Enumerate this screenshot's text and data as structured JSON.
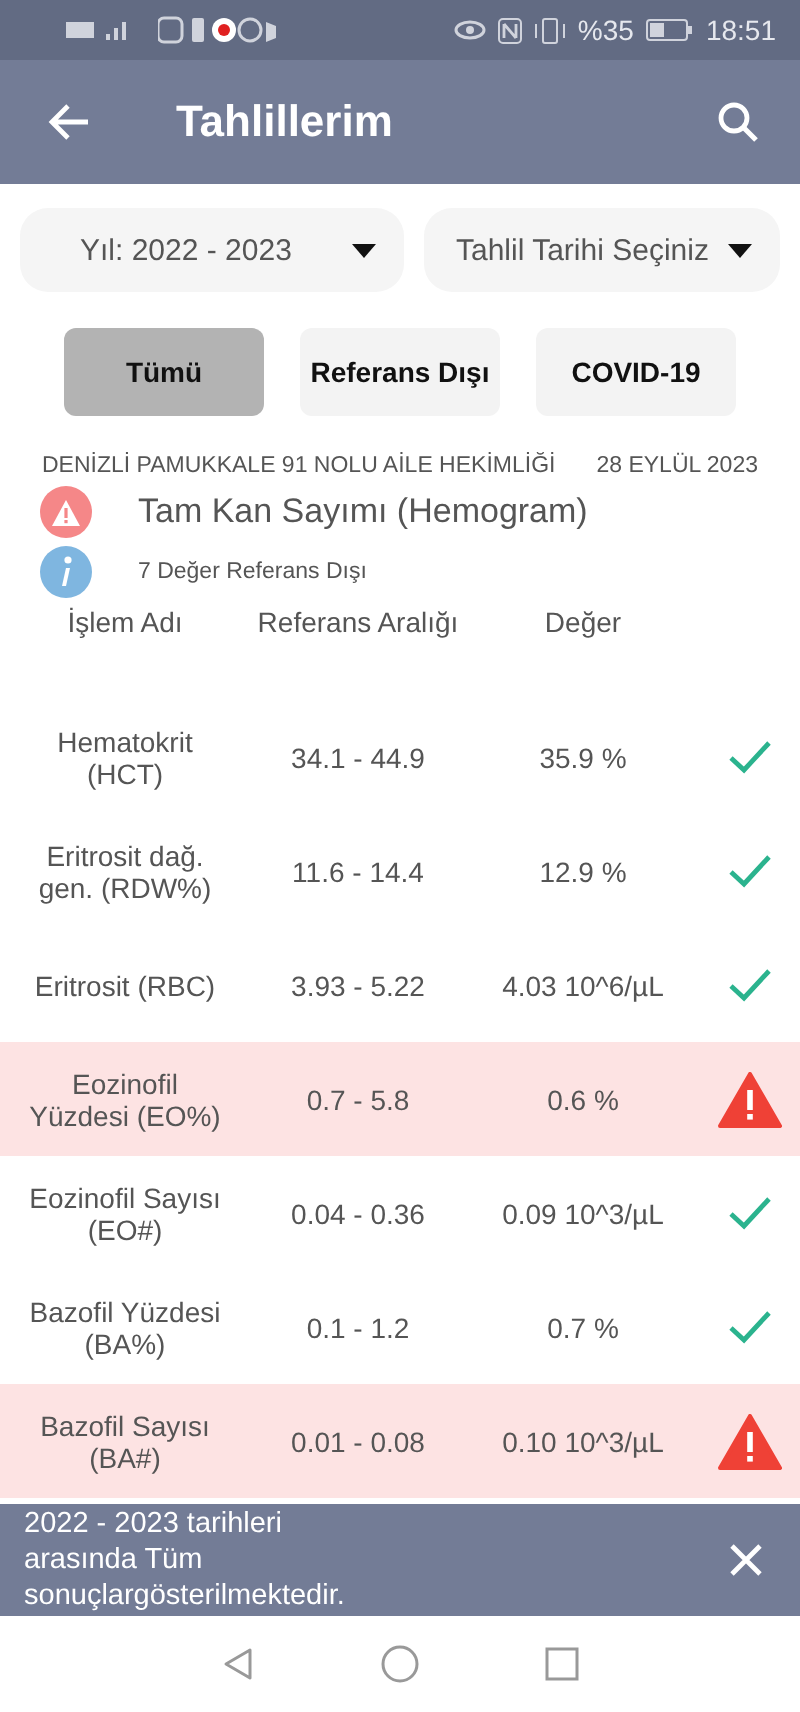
{
  "status_bar": {
    "battery": "%35",
    "time": "18:51"
  },
  "app_bar": {
    "title": "Tahlillerim"
  },
  "filters": {
    "year": "Yıl: 2022 - 2023",
    "date": {
      "placeholder": "Tahlil Tarihi Seçiniz"
    }
  },
  "tabs": [
    {
      "label": "Tümü",
      "selected": true
    },
    {
      "label": "Referans Dışı",
      "selected": false
    },
    {
      "label": "COVID-19",
      "selected": false
    }
  ],
  "report": {
    "institution": "DENİZLİ PAMUKKALE 91 NOLU AİLE HEKİMLİĞİ",
    "date": "28 EYLÜL 2023",
    "title": "Tam Kan Sayımı (Hemogram)",
    "summary": "7 Değer Referans Dışı"
  },
  "table": {
    "columns": [
      "İşlem Adı",
      "Referans Aralığı",
      "Değer"
    ],
    "rows": [
      {
        "name": "Hematokrit (HCT)",
        "range": "34.1 - 44.9",
        "value": "35.9 %",
        "out_of_range": false
      },
      {
        "name": "Eritrosit dağ. gen. (RDW%)",
        "range": "11.6 - 14.4",
        "value": "12.9 %",
        "out_of_range": false
      },
      {
        "name": "Eritrosit (RBC)",
        "range": "3.93 - 5.22",
        "value": "4.03 10^6/µL",
        "out_of_range": false
      },
      {
        "name": "Eozinofil Yüzdesi (EO%)",
        "range": "0.7 - 5.8",
        "value": "0.6 %",
        "out_of_range": true
      },
      {
        "name": "Eozinofil Sayısı (EO#)",
        "range": "0.04 - 0.36",
        "value": "0.09 10^3/µL",
        "out_of_range": false
      },
      {
        "name": "Bazofil Yüzdesi (BA%)",
        "range": "0.1 - 1.2",
        "value": "0.7 %",
        "out_of_range": false
      },
      {
        "name": "Bazofil Sayısı (BA#)",
        "range": "0.01 - 0.08",
        "value": "0.10 10^3/µL",
        "out_of_range": true
      }
    ]
  },
  "snackbar": {
    "message": "2022 - 2023 tarihleri arasında Tüm sonuçlargösterilmektedir."
  }
}
